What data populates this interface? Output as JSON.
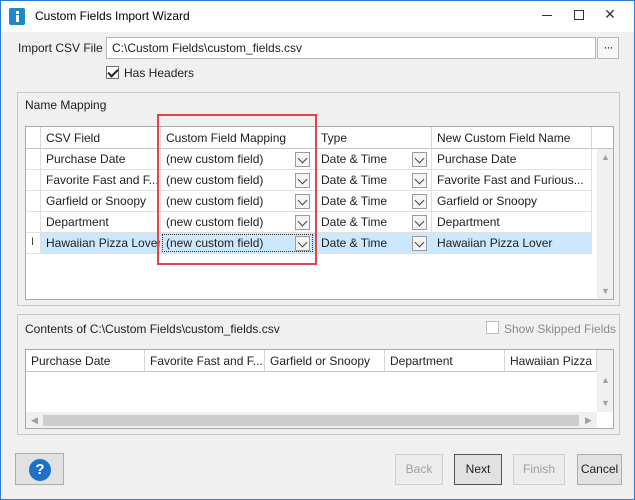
{
  "window": {
    "title": "Custom Fields Import Wizard"
  },
  "import": {
    "label": "Import CSV File",
    "path": "C:\\Custom Fields\\custom_fields.csv",
    "browse_label": "···",
    "has_headers_label": "Has Headers",
    "has_headers_checked": true
  },
  "mapping": {
    "group_title": "Name Mapping",
    "columns": [
      "CSV Field",
      "Custom Field Mapping",
      "Type",
      "New Custom Field Name"
    ],
    "rows": [
      {
        "csv_field": "Purchase Date",
        "mapping": "(new custom field)",
        "type": "Date & Time",
        "name": "Purchase Date"
      },
      {
        "csv_field": "Favorite Fast and F...",
        "mapping": "(new custom field)",
        "type": "Date & Time",
        "name": "Favorite Fast and Furious..."
      },
      {
        "csv_field": "Garfield or Snoopy",
        "mapping": "(new custom field)",
        "type": "Date & Time",
        "name": "Garfield or Snoopy"
      },
      {
        "csv_field": "Department",
        "mapping": "(new custom field)",
        "type": "Date & Time",
        "name": "Department"
      },
      {
        "csv_field": "Hawaiian Pizza Lover",
        "mapping": "(new custom field)",
        "type": "Date & Time",
        "name": "Hawaiian Pizza Lover"
      }
    ],
    "selected_row": 4
  },
  "contents": {
    "group_title": "Contents of C:\\Custom Fields\\custom_fields.csv",
    "show_skipped_label": "Show Skipped Fields",
    "show_skipped_checked": false,
    "columns": [
      "Purchase Date",
      "Favorite Fast and F...",
      "Garfield or Snoopy",
      "Department",
      "Hawaiian Pizza L"
    ]
  },
  "buttons": {
    "help": "?",
    "back": "Back",
    "next": "Next",
    "finish": "Finish",
    "cancel": "Cancel"
  },
  "colors": {
    "selection": "#cce8ff",
    "highlight_box": "#e54548",
    "help_icon": "#1c72c9",
    "title_bar_border": "#2b7cd3"
  }
}
